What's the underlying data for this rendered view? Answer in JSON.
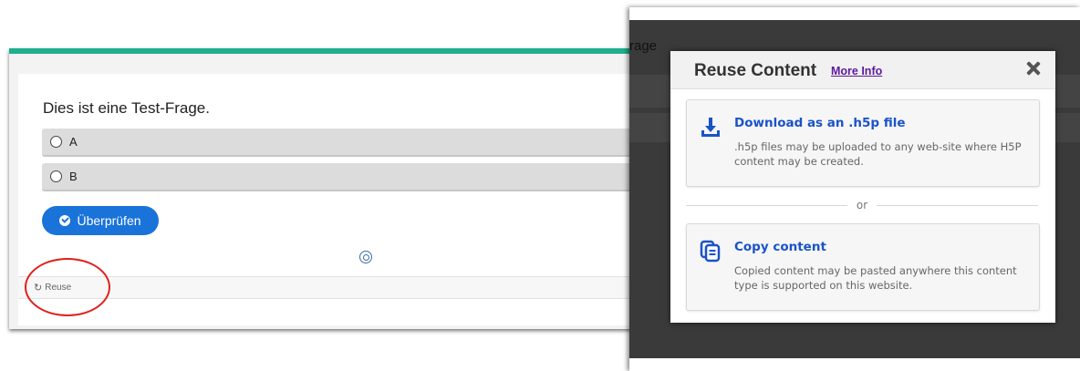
{
  "question": {
    "text": "Dies ist eine Test-Frage.",
    "answers": [
      {
        "label": "A"
      },
      {
        "label": "B"
      }
    ],
    "check_button_label": "Überprüfen"
  },
  "footer": {
    "reuse_label": "Reuse"
  },
  "background_fragment": {
    "text": "rage"
  },
  "dialog": {
    "title": "Reuse Content",
    "more_info_label": "More Info",
    "download": {
      "title": "Download as an .h5p file",
      "description": ".h5p files may be uploaded to any web-site where H5P content may be created."
    },
    "divider_label": "or",
    "copy": {
      "title": "Copy content",
      "description": "Copied content may be pasted anywhere this content type is supported on this website."
    }
  },
  "colors": {
    "accent_top_border": "#1eaf8f",
    "primary_button": "#1a73d9",
    "highlight_ellipse": "#e0201c",
    "dialog_link": "#1a53c8",
    "more_info_link": "#5c1a9e"
  },
  "icons": [
    "check-circle-icon",
    "reuse-icon",
    "spinner-icon",
    "close-icon",
    "download-icon",
    "copy-icon"
  ]
}
